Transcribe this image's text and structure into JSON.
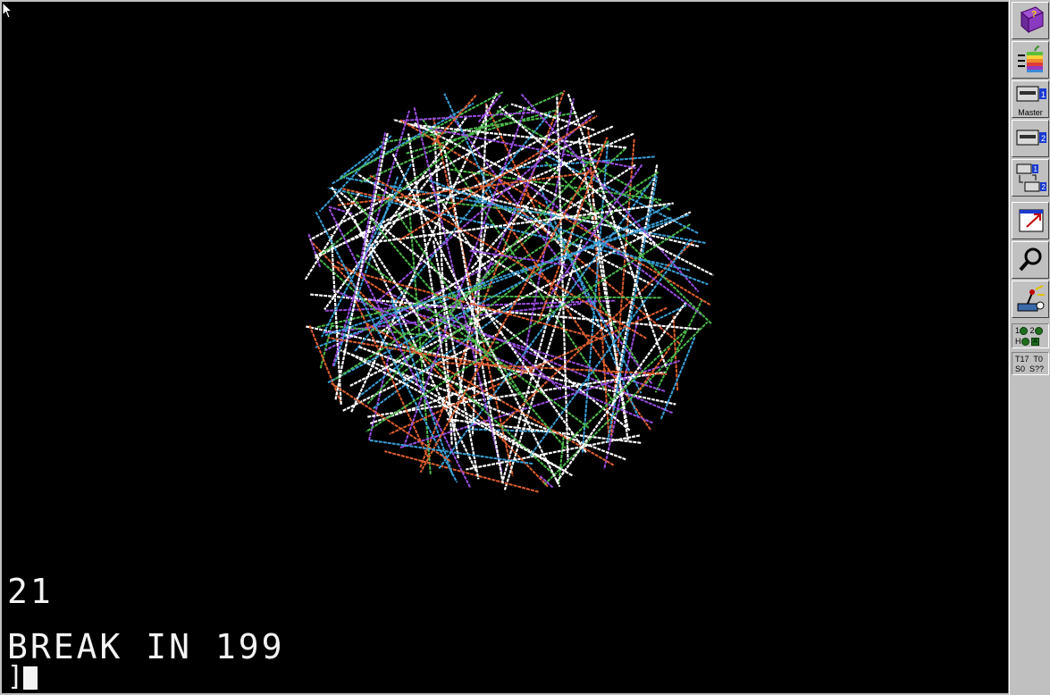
{
  "screen": {
    "background": "#000000",
    "text_color": "#f4f4f4",
    "counter_text": "21",
    "break_text": "BREAK IN 199",
    "prompt_symbol": "]",
    "graphics_colors": [
      "#ffffff",
      "#9a4fe0",
      "#3aa0d8",
      "#4cb84c",
      "#e06030"
    ]
  },
  "toolbar": {
    "buttons": [
      {
        "icon": "help-book-icon"
      },
      {
        "icon": "apple-run-icon"
      },
      {
        "icon": "drive-1-icon",
        "label": "Master"
      },
      {
        "icon": "drive-2-icon"
      },
      {
        "icon": "swap-drives-icon"
      },
      {
        "icon": "fullscreen-icon"
      },
      {
        "icon": "debugger-magnifier-icon"
      },
      {
        "icon": "settings-joystick-icon"
      }
    ],
    "leds": {
      "row1_a": "1",
      "row1_b": "2",
      "row2_a": "H",
      "row2_b_box": "A"
    },
    "track_info": {
      "t1": "T17",
      "t2": "T0",
      "s1": "S0",
      "s2": "S??"
    }
  }
}
